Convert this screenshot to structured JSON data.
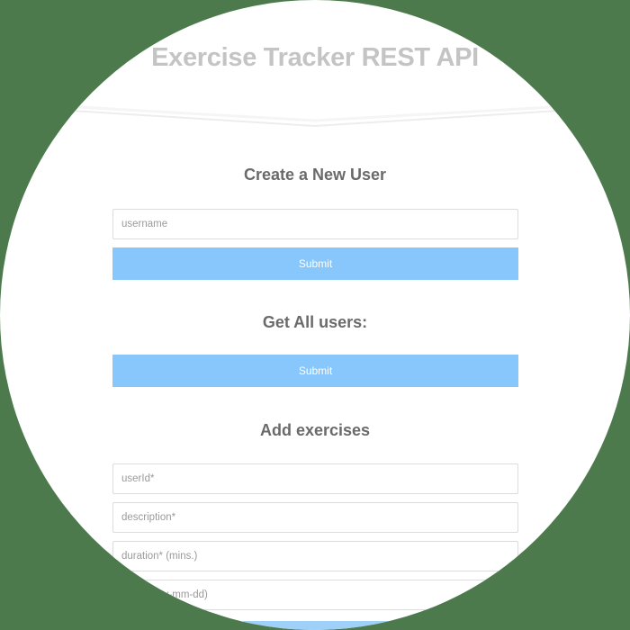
{
  "header": {
    "title": "Exercise Tracker REST API"
  },
  "create_user": {
    "title": "Create a New User",
    "username_placeholder": "username",
    "submit_label": "Submit"
  },
  "get_users": {
    "title": "Get All users:",
    "submit_label": "Submit"
  },
  "add_exercises": {
    "title": "Add exercises",
    "userid_placeholder": "userId*",
    "description_placeholder": "description*",
    "duration_placeholder": "duration* (mins.)",
    "date_placeholder": "date (yyyy-mm-dd)"
  },
  "colors": {
    "background": "#4c7a4c",
    "button": "#87c7fb",
    "title": "#c4c4c4",
    "heading": "#6a6a6a"
  }
}
